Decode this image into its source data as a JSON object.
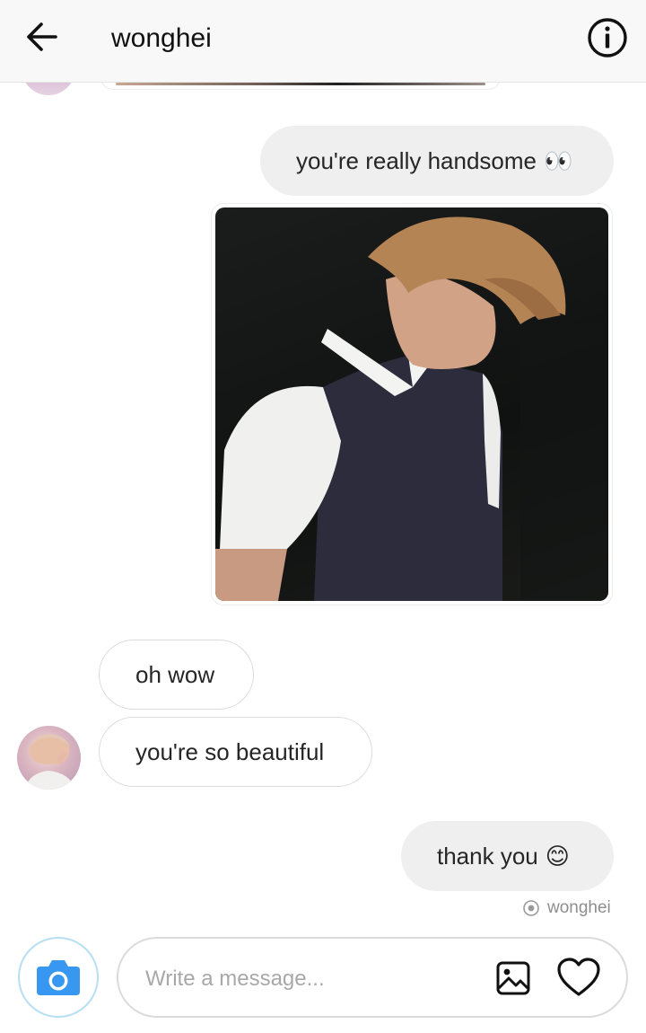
{
  "header": {
    "title": "wonghei",
    "back_icon": "arrow-left-icon",
    "info_icon": "info-circle-icon"
  },
  "messages": [
    {
      "from": "me",
      "text": "you're really handsome",
      "emoji": "👀"
    },
    {
      "from": "me",
      "type": "photo"
    },
    {
      "from": "them",
      "text": "oh wow"
    },
    {
      "from": "them",
      "text": "you're so beautiful"
    },
    {
      "from": "me",
      "text": "thank you",
      "emoji": "😊"
    }
  ],
  "seen": {
    "icon": "seen-eye-icon",
    "label": "wonghei"
  },
  "composer": {
    "placeholder": "Write a message...",
    "camera_icon": "camera-icon",
    "gallery_icon": "image-icon",
    "like_icon": "heart-icon"
  },
  "colors": {
    "sent_bubble": "#efefef",
    "received_border": "#dbdbdb",
    "camera_blue": "#3897f0"
  }
}
